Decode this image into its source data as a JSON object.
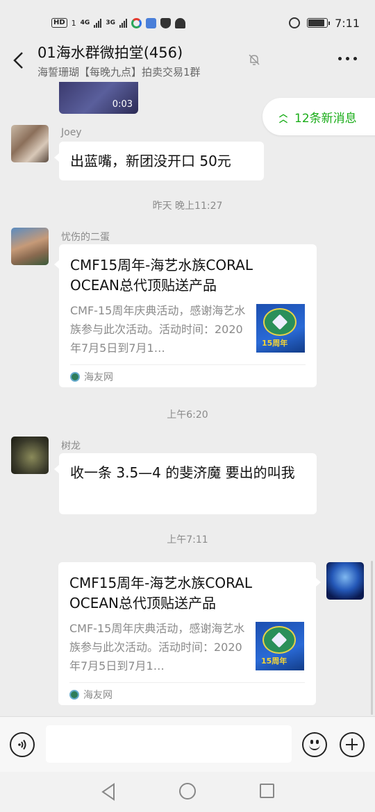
{
  "status_bar": {
    "hd_label": "HD",
    "hd_sub": "1",
    "net1": "4G",
    "net2": "3G",
    "time": "7:11",
    "battery_level": 0.9
  },
  "header": {
    "title": "01海水群微拍堂(456)",
    "subtitle": "海誓珊瑚【每晚九点】拍卖交易1群"
  },
  "video": {
    "duration": "0:03"
  },
  "new_messages": {
    "label": "12条新消息",
    "accent": "#1aad19"
  },
  "messages": [
    {
      "sender": "Joey",
      "text": "出蓝嘴，新团没开口 50元"
    },
    {
      "timestamp": "昨天 晚上11:27"
    },
    {
      "sender": "忧伤的二蛋",
      "card": {
        "title": "CMF15周年-海艺水族CORAL OCEAN总代顶贴送产品",
        "desc": "CMF-15周年庆典活动，感谢海艺水族参与此次活动。活动时间：2020年7月5日到7月1…",
        "source": "海友网",
        "thumb_text": "15周年"
      }
    },
    {
      "timestamp": "上午6:20"
    },
    {
      "sender": "树龙",
      "text": "收一条 3.5—4 的斐济魔   要出的叫我"
    },
    {
      "timestamp": "上午7:11"
    },
    {
      "self": true,
      "card": {
        "title": "CMF15周年-海艺水族CORAL OCEAN总代顶贴送产品",
        "desc": "CMF-15周年庆典活动，感谢海艺水族参与此次活动。活动时间：2020年7月5日到7月1…",
        "source": "海友网",
        "thumb_text": "15周年"
      }
    }
  ],
  "icons": {
    "back": "chevron-left-icon",
    "mute": "bell-off-icon",
    "more": "more-dots-icon",
    "voice": "voice-icon",
    "emoji": "emoji-icon",
    "plus": "plus-icon"
  }
}
